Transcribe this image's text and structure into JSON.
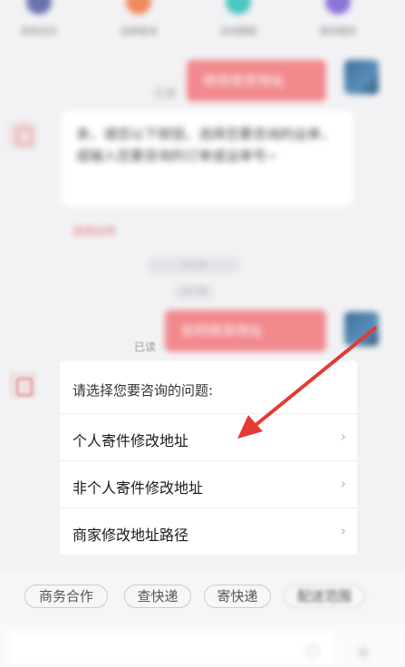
{
  "shortcuts": [
    {
      "label": "商务合作",
      "color": "#6c72b0"
    },
    {
      "label": "运单查询",
      "color": "#f08a5c"
    },
    {
      "label": "在线客服",
      "color": "#4ac5c0"
    },
    {
      "label": "更多服务",
      "color": "#8d72d8"
    }
  ],
  "chat": {
    "user_msg_1": "修改收货地址",
    "read_label_1": "已读",
    "bot_msg_1": "亲，请您以下按钮，选择您要咨询的运单，或输入您要咨询的订单或运单号~",
    "bot_link_1": "选择运单",
    "time_1": "12:34",
    "time_2": "12:35",
    "user_msg_2": "如何修改地址",
    "read_label_2": "已读"
  },
  "question_card": {
    "title": "请选择您要咨询的问题:",
    "items": [
      "个人寄件修改地址",
      "非个人寄件修改地址",
      "商家修改地址路径"
    ]
  },
  "chips": [
    "商务合作",
    "查快递",
    "寄快递",
    "配送范围"
  ],
  "colors": {
    "accent": "#f1898d",
    "arrow": "#e53935"
  }
}
